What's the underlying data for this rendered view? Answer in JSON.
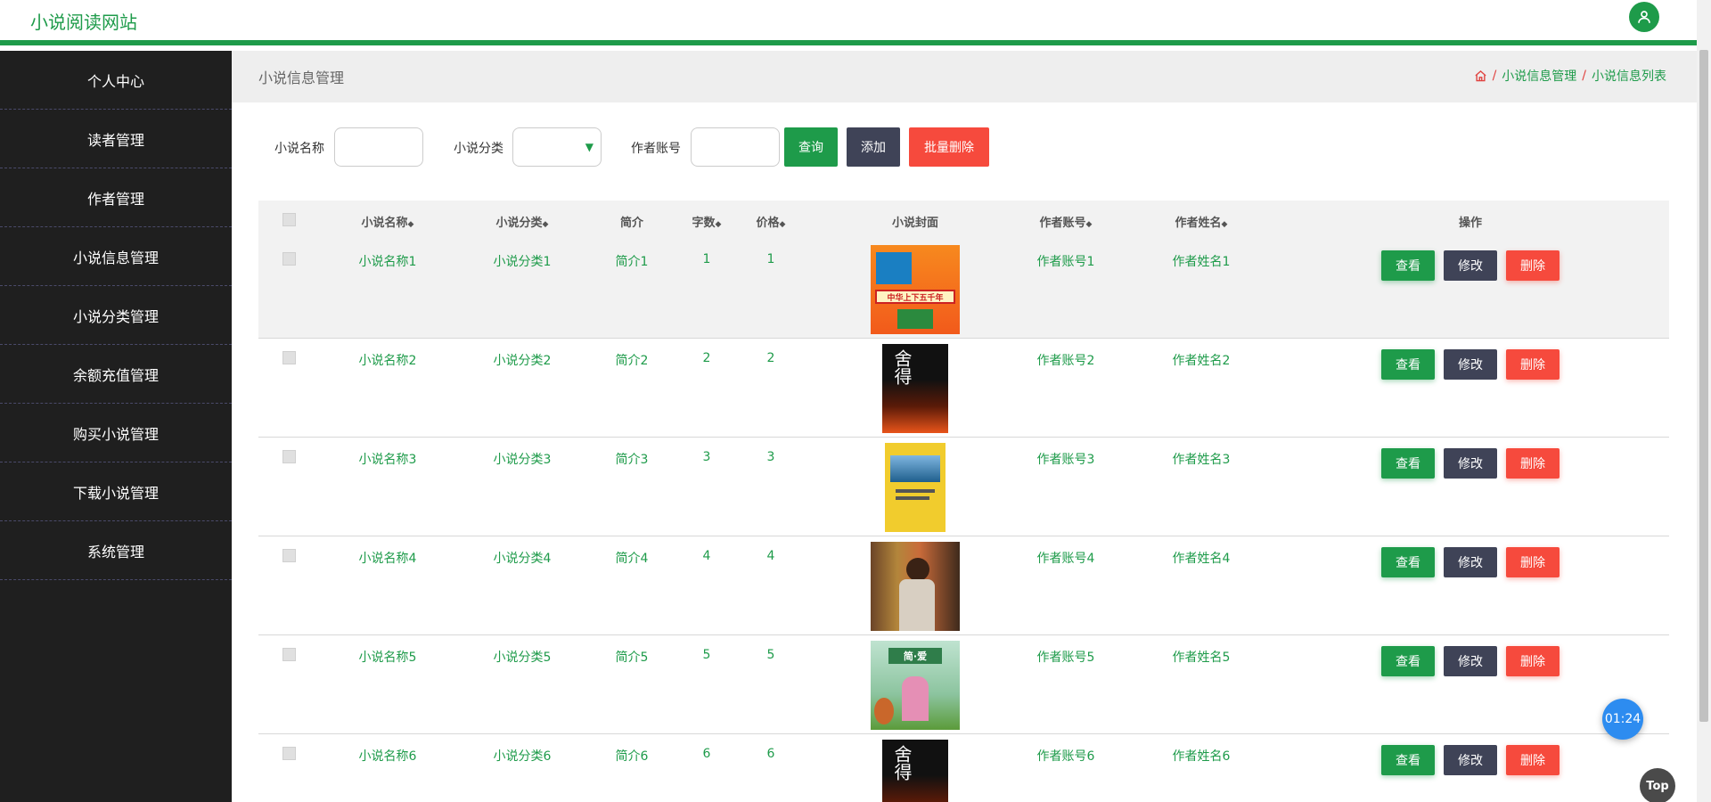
{
  "header": {
    "site_title": "小说阅读网站"
  },
  "sidebar": {
    "items": [
      {
        "label": "个人中心"
      },
      {
        "label": "读者管理"
      },
      {
        "label": "作者管理"
      },
      {
        "label": "小说信息管理"
      },
      {
        "label": "小说分类管理"
      },
      {
        "label": "余额充值管理"
      },
      {
        "label": "购买小说管理"
      },
      {
        "label": "下载小说管理"
      },
      {
        "label": "系统管理"
      }
    ]
  },
  "page": {
    "title": "小说信息管理",
    "breadcrumb": [
      "小说信息管理",
      "小说信息列表"
    ]
  },
  "search": {
    "name_label": "小说名称",
    "name_value": "",
    "category_label": "小说分类",
    "category_value": "",
    "author_label": "作者账号",
    "author_value": "",
    "query_label": "查询",
    "add_label": "添加",
    "batch_delete_label": "批量删除"
  },
  "table": {
    "headers": {
      "name": "小说名称",
      "category": "小说分类",
      "intro": "简介",
      "words": "字数",
      "price": "价格",
      "cover": "小说封面",
      "author_account": "作者账号",
      "author_name": "作者姓名",
      "ops": "操作"
    },
    "buttons": {
      "view": "查看",
      "edit": "修改",
      "delete": "删除"
    },
    "rows": [
      {
        "name": "小说名称1",
        "category": "小说分类1",
        "intro": "简介1",
        "words": "1",
        "price": "1",
        "cover_title": "中华上下五千年",
        "author_account": "作者账号1",
        "author_name": "作者姓名1"
      },
      {
        "name": "小说名称2",
        "category": "小说分类2",
        "intro": "简介2",
        "words": "2",
        "price": "2",
        "cover_title": "舍得",
        "author_account": "作者账号2",
        "author_name": "作者姓名2"
      },
      {
        "name": "小说名称3",
        "category": "小说分类3",
        "intro": "简介3",
        "words": "3",
        "price": "3",
        "cover_title": "",
        "author_account": "作者账号3",
        "author_name": "作者姓名3"
      },
      {
        "name": "小说名称4",
        "category": "小说分类4",
        "intro": "简介4",
        "words": "4",
        "price": "4",
        "cover_title": "",
        "author_account": "作者账号4",
        "author_name": "作者姓名4"
      },
      {
        "name": "小说名称5",
        "category": "小说分类5",
        "intro": "简介5",
        "words": "5",
        "price": "5",
        "cover_title": "简·爱",
        "author_account": "作者账号5",
        "author_name": "作者姓名5"
      },
      {
        "name": "小说名称6",
        "category": "小说分类6",
        "intro": "简介6",
        "words": "6",
        "price": "6",
        "cover_title": "舍得",
        "author_account": "作者账号6",
        "author_name": "作者姓名6"
      }
    ]
  },
  "floating": {
    "timer": "01:24",
    "top_label": "Top"
  },
  "colors": {
    "accent": "#1e9b4a",
    "dark": "#3f4357",
    "danger": "#f64a3d",
    "sidebar": "#1f1f1f"
  }
}
